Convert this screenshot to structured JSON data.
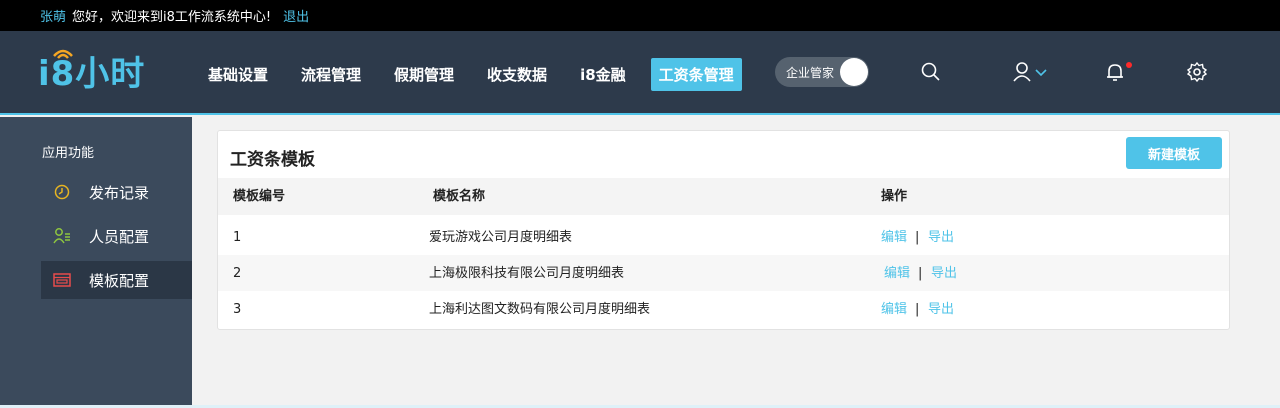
{
  "topbar": {
    "user_name": "张萌",
    "greeting": "您好，欢迎来到i8工作流系统中心!",
    "logout_label": "退出"
  },
  "header": {
    "logo_text": "i8小时",
    "nav": [
      {
        "label": "基础设置",
        "active": false
      },
      {
        "label": "流程管理",
        "active": false
      },
      {
        "label": "假期管理",
        "active": false
      },
      {
        "label": "收支数据",
        "active": false
      },
      {
        "label": "i8金融",
        "active": false
      },
      {
        "label": "工资条管理",
        "active": true
      }
    ],
    "toggle_label": "企业管家",
    "icons": [
      "search-icon",
      "user-icon",
      "bell-icon",
      "gear-icon"
    ]
  },
  "sidebar": {
    "title": "应用功能",
    "items": [
      {
        "label": "发布记录",
        "icon": "clock-icon",
        "active": false
      },
      {
        "label": "人员配置",
        "icon": "user-config-icon",
        "active": false
      },
      {
        "label": "模板配置",
        "icon": "template-icon",
        "active": true
      }
    ]
  },
  "main": {
    "title": "工资条模板",
    "new_button": "新建模板",
    "columns": [
      "模板编号",
      "模板名称",
      "操作"
    ],
    "rows": [
      {
        "id": "1",
        "name": "爱玩游戏公司月度明细表",
        "edit": "编辑",
        "sep": "|",
        "export": "导出"
      },
      {
        "id": "2",
        "name": "上海极限科技有限公司月度明细表",
        "edit": "编辑",
        "sep": "|",
        "export": "导出"
      },
      {
        "id": "3",
        "name": "上海利达图文数码有限公司月度明细表",
        "edit": "编辑",
        "sep": "|",
        "export": "导出"
      }
    ]
  },
  "colors": {
    "accent": "#4fc3e8",
    "header_bg": "#2d3a4b",
    "sidebar_bg": "#3b4a5c",
    "notification_dot": "#ff2a2a"
  }
}
